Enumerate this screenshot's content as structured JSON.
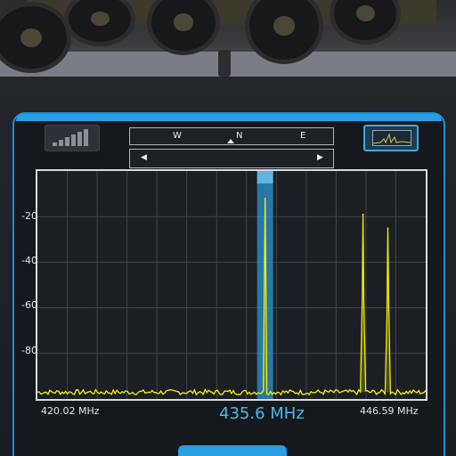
{
  "compass": {
    "w": "W",
    "n": "N",
    "e": "E"
  },
  "scan": {
    "left_icon": "caret-left-icon",
    "right_icon": "caret-right-icon"
  },
  "axis": {
    "y_ticks": [
      "-20",
      "-40",
      "-60",
      "-80"
    ],
    "x_min_label": "420.02 MHz",
    "x_max_label": "446.59 MHz"
  },
  "current_frequency": "435.6 MHz",
  "colors": {
    "accent": "#2aa0e6",
    "trace": "#f4f20a",
    "selection": "#2f9de0"
  },
  "chart_data": {
    "type": "line",
    "x_range": [
      420.02,
      446.59
    ],
    "y_ticks": [
      -20,
      -40,
      -60,
      -80
    ],
    "ylim": [
      -100,
      0
    ],
    "selected_frequency": 435.6,
    "peaks": [
      {
        "freq": 435.6,
        "level": -12
      },
      {
        "freq": 442.3,
        "level": -19
      },
      {
        "freq": 444.0,
        "level": -25
      }
    ],
    "noise_floor": -97
  }
}
